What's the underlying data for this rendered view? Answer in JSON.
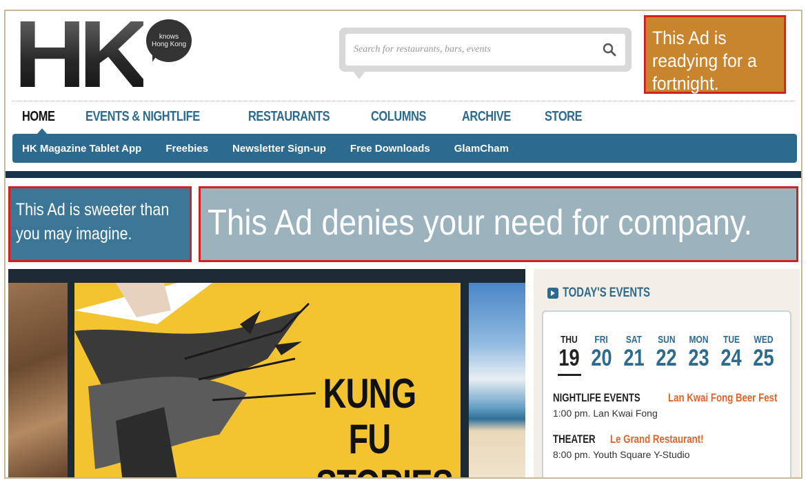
{
  "logo": {
    "letters": "HK",
    "bubble_line1": "knows",
    "bubble_line2": "Hong Kong"
  },
  "search": {
    "placeholder": "Search for restaurants, bars, events",
    "icon": "search-icon"
  },
  "ads": {
    "top_right": "This Ad is readying for a fortnight.",
    "left_line1": "This Ad is sweeter than",
    "left_line2": "you may imagine.",
    "wide": "This Ad denies your need for company."
  },
  "main_nav": {
    "items": [
      "HOME",
      "EVENTS & NIGHTLIFE",
      "RESTAURANTS",
      "COLUMNS",
      "ARCHIVE",
      "STORE"
    ]
  },
  "sub_nav": {
    "items": [
      "HK Magazine Tablet App",
      "Freebies",
      "Newsletter Sign-up",
      "Free Downloads",
      "GlamCham"
    ]
  },
  "hero": {
    "line1": "KUNG FU",
    "line2": "STORIES"
  },
  "events": {
    "title": "TODAY'S EVENTS",
    "days": [
      {
        "dow": "THU",
        "num": "19"
      },
      {
        "dow": "FRI",
        "num": "20"
      },
      {
        "dow": "SAT",
        "num": "21"
      },
      {
        "dow": "SUN",
        "num": "22"
      },
      {
        "dow": "MON",
        "num": "23"
      },
      {
        "dow": "TUE",
        "num": "24"
      },
      {
        "dow": "WED",
        "num": "25"
      }
    ],
    "list": [
      {
        "category": "NIGHTLIFE EVENTS",
        "name": "Lan Kwai Fong Beer Fest",
        "meta": "1:00 pm. Lan Kwai Fong"
      },
      {
        "category": "THEATER",
        "name": "Le Grand Restaurant!",
        "meta": "8:00 pm. Youth Square Y-Studio"
      }
    ]
  },
  "colors": {
    "brand_blue": "#2c6a8f",
    "accent_orange": "#e2632a",
    "ad_border": "#d2201e"
  }
}
